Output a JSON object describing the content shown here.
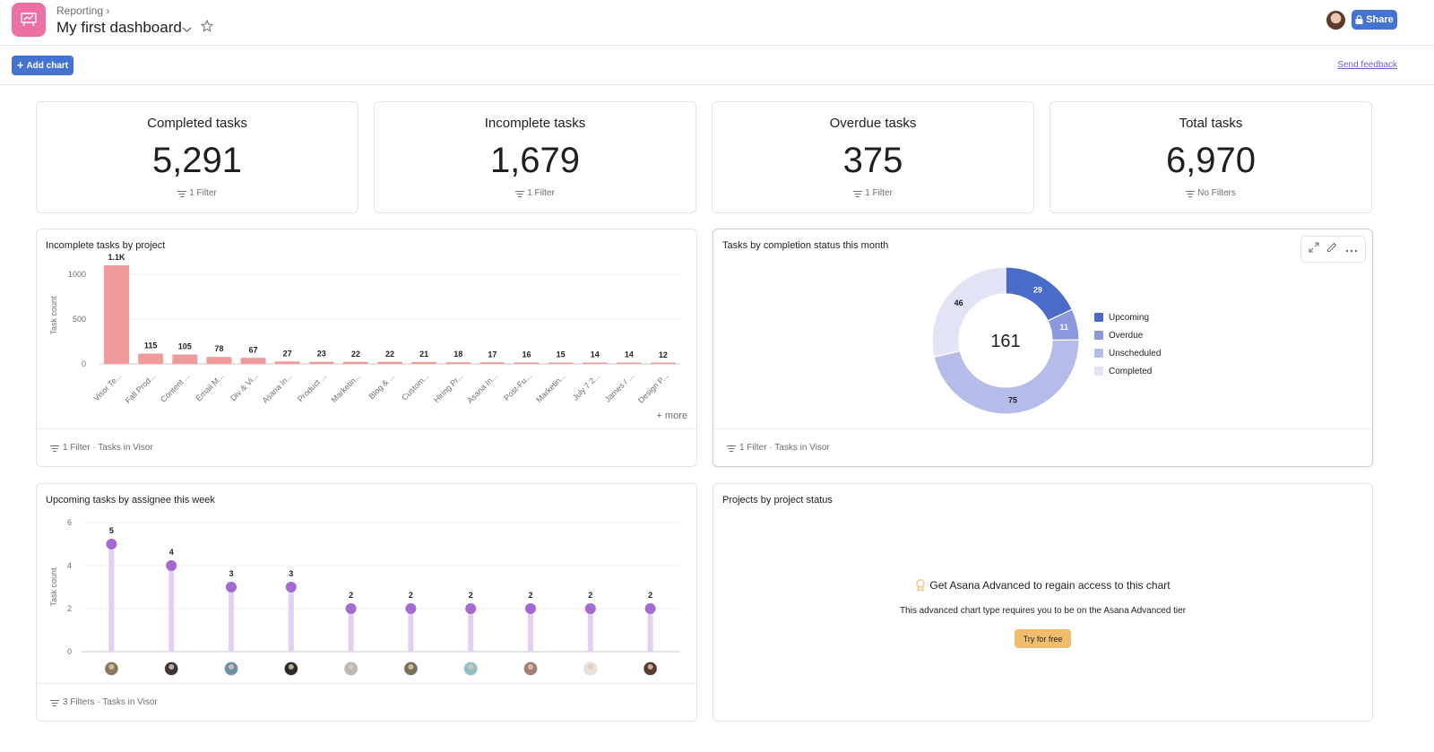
{
  "header": {
    "breadcrumb": "Reporting",
    "breadcrumb_sep": "›",
    "title": "My first dashboard",
    "share_label": "Share",
    "app_icon_color": "#ee6fa6"
  },
  "toolbar": {
    "add_chart_label": "Add chart",
    "send_feedback_label": "Send feedback"
  },
  "kpis": [
    {
      "title": "Completed tasks",
      "value": "5,291",
      "filter": "1 Filter"
    },
    {
      "title": "Incomplete tasks",
      "value": "1,679",
      "filter": "1 Filter"
    },
    {
      "title": "Overdue tasks",
      "value": "375",
      "filter": "1 Filter"
    },
    {
      "title": "Total tasks",
      "value": "6,970",
      "filter": "No Filters"
    }
  ],
  "charts": {
    "incomplete_by_project": {
      "title": "Incomplete tasks by project",
      "footer": "1 Filter · Tasks in Visor",
      "more_label": "+ more"
    },
    "completion_status": {
      "title": "Tasks by completion status this month",
      "footer": "1 Filter · Tasks in Visor",
      "center_total": "161"
    },
    "upcoming_by_assignee": {
      "title": "Upcoming tasks by assignee this week",
      "footer": "3 Filters · Tasks in Visor"
    },
    "projects_by_status": {
      "title": "Projects by project status",
      "lock_title": "Get Asana Advanced to regain access to this chart",
      "lock_subtitle": "This advanced chart type requires you to be on the Asana Advanced tier",
      "try_label": "Try for free"
    }
  },
  "chart_data": [
    {
      "type": "bar",
      "title": "Incomplete tasks by project",
      "xlabel": "",
      "ylabel": "Task count",
      "ylim": [
        0,
        1200
      ],
      "yticks": [
        0,
        500,
        1000
      ],
      "grid": true,
      "color": "#f09b9b",
      "categories": [
        "Visor Te...",
        "Fall Prod...",
        "Content ...",
        "Email M...",
        "Div & Vi...",
        "Asana In...",
        "Product ...",
        "Marketin...",
        "Blog & ...",
        "Custom...",
        "Hiring Pr...",
        "Asana In...",
        "Post-Fu...",
        "Marketin...",
        "July 7 2...",
        "James / ...",
        "Design P..."
      ],
      "values": [
        1100,
        115,
        105,
        78,
        67,
        27,
        23,
        22,
        22,
        21,
        18,
        17,
        16,
        15,
        14,
        14,
        12
      ],
      "labels": [
        "1.1K",
        "115",
        "105",
        "78",
        "67",
        "27",
        "23",
        "22",
        "22",
        "21",
        "18",
        "17",
        "16",
        "15",
        "14",
        "14",
        "12"
      ]
    },
    {
      "type": "pie",
      "title": "Tasks by completion status this month",
      "donut": true,
      "center_label": "161",
      "legend": "right",
      "slices": [
        {
          "name": "Upcoming",
          "value": 29,
          "color": "#4a6bc8"
        },
        {
          "name": "Overdue",
          "value": 11,
          "color": "#8b98dd"
        },
        {
          "name": "Unscheduled",
          "value": 75,
          "color": "#b5bce9"
        },
        {
          "name": "Completed",
          "value": 46,
          "color": "#e2e3f5"
        }
      ]
    },
    {
      "type": "scatter",
      "style": "lollipop",
      "title": "Upcoming tasks by assignee this week",
      "xlabel": "",
      "ylabel": "Task count",
      "ylim": [
        0,
        6
      ],
      "yticks": [
        0,
        2,
        4,
        6
      ],
      "grid": true,
      "color": "#a56ad0",
      "stem_color": "#e3d0f1",
      "categories": [
        "assignee-1",
        "assignee-2",
        "assignee-3",
        "assignee-4",
        "assignee-5",
        "assignee-6",
        "assignee-7",
        "assignee-8",
        "assignee-9",
        "assignee-10"
      ],
      "avatar_colors": [
        "#8a7a5c",
        "#3a3535",
        "#6b8fa8",
        "#2a2a2a",
        "#b8b8b8",
        "#7a7058",
        "#8fc0c8",
        "#a08070",
        "#e8e0dc",
        "#5a3a30"
      ],
      "values": [
        5,
        4,
        3,
        3,
        2,
        2,
        2,
        2,
        2,
        2
      ]
    }
  ]
}
